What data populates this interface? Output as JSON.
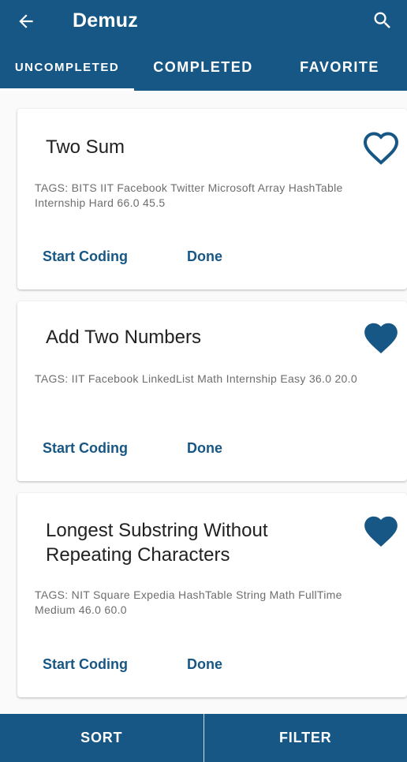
{
  "app_bar": {
    "title": "Demuz",
    "back_icon": "arrow-back-icon",
    "search_icon": "search-icon",
    "background_color": "#175785"
  },
  "tabs": [
    {
      "label": "UNCOMPLETED",
      "selected": true
    },
    {
      "label": "COMPLETED",
      "selected": false
    },
    {
      "label": "FAVORITE",
      "selected": false
    }
  ],
  "problems": [
    {
      "title": "Two Sum",
      "tags": "TAGS: BITS  IIT Facebook  Twitter  Microsoft Array  HashTable Internship Hard 66.0 45.5",
      "favorite": false,
      "start_label": "Start Coding",
      "done_label": "Done"
    },
    {
      "title": "Add Two Numbers",
      "tags": "TAGS: IIT Facebook LinkedList  Math Internship Easy 36.0 20.0",
      "favorite": true,
      "start_label": "Start Coding",
      "done_label": "Done"
    },
    {
      "title": "Longest Substring Without Repeating Characters",
      "tags": "TAGS: NIT Square  Expedia HashTable  String  Math FullTime Medium 46.0 60.0",
      "favorite": true,
      "start_label": "Start Coding",
      "done_label": "Done"
    }
  ],
  "bottom_bar": {
    "sort_label": "SORT",
    "filter_label": "FILTER"
  },
  "colors": {
    "accent": "#175785",
    "heart": "#175785"
  }
}
